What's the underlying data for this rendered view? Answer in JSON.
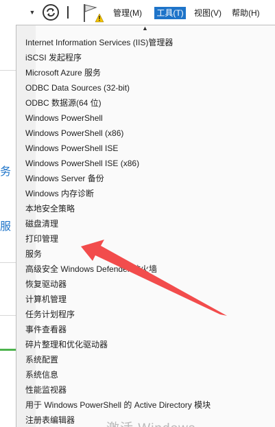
{
  "menubar": {
    "manage": "管理(M)",
    "tools": "工具(T)",
    "view": "视图(V)",
    "help": "帮助(H)"
  },
  "toolbar": {
    "refresh_icon": "refresh-icon",
    "flag_icon": "notification-flag-icon",
    "dropdown_icon": "dropdown-arrow-icon",
    "warning_color": "#f5c400"
  },
  "background": {
    "text1": "务",
    "text2": "服"
  },
  "tools_menu": {
    "items": [
      "Internet Information Services (IIS)管理器",
      "iSCSI 发起程序",
      "Microsoft Azure 服务",
      "ODBC Data Sources (32-bit)",
      "ODBC 数据源(64 位)",
      "Windows PowerShell",
      "Windows PowerShell (x86)",
      "Windows PowerShell ISE",
      "Windows PowerShell ISE (x86)",
      "Windows Server 备份",
      "Windows 内存诊断",
      "本地安全策略",
      "磁盘清理",
      "打印管理",
      "服务",
      "高级安全 Windows Defender 防火墙",
      "恢复驱动器",
      "计算机管理",
      "任务计划程序",
      "事件查看器",
      "碎片整理和优化驱动器",
      "系统配置",
      "系统信息",
      "性能监视器",
      "用于 Windows PowerShell 的 Active Directory 模块",
      "注册表编辑器"
    ]
  },
  "annotation": {
    "arrow_color": "#f24c4c",
    "points_to": "打印管理"
  },
  "watermark": "激活 Windows"
}
